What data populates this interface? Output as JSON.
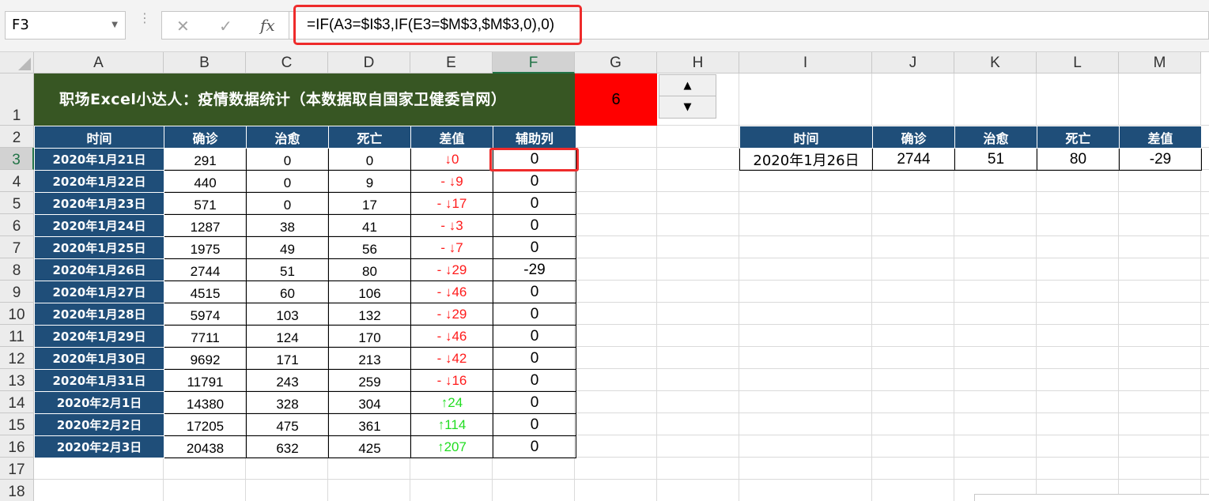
{
  "formula_bar": {
    "name_box": "F3",
    "cancel_glyph": "✕",
    "enter_glyph": "✓",
    "fx_label": "fx",
    "formula": "=IF(A3=$I$3,IF(E3=$M$3,$M$3,0),0)"
  },
  "columns": [
    "A",
    "B",
    "C",
    "D",
    "E",
    "F",
    "G",
    "H",
    "I",
    "J",
    "K",
    "L",
    "M"
  ],
  "selected_column": "F",
  "rows": [
    "1",
    "2",
    "3",
    "4",
    "5",
    "6",
    "7",
    "8",
    "9",
    "10",
    "11",
    "12",
    "13",
    "14",
    "15",
    "16",
    "17",
    "18"
  ],
  "selected_row": "3",
  "title": "职场Excel小达人：疫情数据统计（本数据取自国家卫健委官网）",
  "spinner_value": "6",
  "spinner": {
    "up": "▲",
    "down": "▼"
  },
  "main_table": {
    "headers": [
      "时间",
      "确诊",
      "治愈",
      "死亡",
      "差值",
      "辅助列"
    ],
    "rows": [
      {
        "date": "2020年1月21日",
        "confirmed": "291",
        "cured": "0",
        "dead": "0",
        "diff": "↓0",
        "dir": "down",
        "aux": "0"
      },
      {
        "date": "2020年1月22日",
        "confirmed": "440",
        "cured": "0",
        "dead": "9",
        "diff": "- ↓9",
        "dir": "down",
        "aux": "0"
      },
      {
        "date": "2020年1月23日",
        "confirmed": "571",
        "cured": "0",
        "dead": "17",
        "diff": "- ↓17",
        "dir": "down",
        "aux": "0"
      },
      {
        "date": "2020年1月24日",
        "confirmed": "1287",
        "cured": "38",
        "dead": "41",
        "diff": "- ↓3",
        "dir": "down",
        "aux": "0"
      },
      {
        "date": "2020年1月25日",
        "confirmed": "1975",
        "cured": "49",
        "dead": "56",
        "diff": "- ↓7",
        "dir": "down",
        "aux": "0"
      },
      {
        "date": "2020年1月26日",
        "confirmed": "2744",
        "cured": "51",
        "dead": "80",
        "diff": "- ↓29",
        "dir": "down",
        "aux": "-29"
      },
      {
        "date": "2020年1月27日",
        "confirmed": "4515",
        "cured": "60",
        "dead": "106",
        "diff": "- ↓46",
        "dir": "down",
        "aux": "0"
      },
      {
        "date": "2020年1月28日",
        "confirmed": "5974",
        "cured": "103",
        "dead": "132",
        "diff": "- ↓29",
        "dir": "down",
        "aux": "0"
      },
      {
        "date": "2020年1月29日",
        "confirmed": "7711",
        "cured": "124",
        "dead": "170",
        "diff": "- ↓46",
        "dir": "down",
        "aux": "0"
      },
      {
        "date": "2020年1月30日",
        "confirmed": "9692",
        "cured": "171",
        "dead": "213",
        "diff": "- ↓42",
        "dir": "down",
        "aux": "0"
      },
      {
        "date": "2020年1月31日",
        "confirmed": "11791",
        "cured": "243",
        "dead": "259",
        "diff": "- ↓16",
        "dir": "down",
        "aux": "0"
      },
      {
        "date": "2020年2月1日",
        "confirmed": "14380",
        "cured": "328",
        "dead": "304",
        "diff": "↑24",
        "dir": "up",
        "aux": "0"
      },
      {
        "date": "2020年2月2日",
        "confirmed": "17205",
        "cured": "475",
        "dead": "361",
        "diff": "↑114",
        "dir": "up",
        "aux": "0"
      },
      {
        "date": "2020年2月3日",
        "confirmed": "20438",
        "cured": "632",
        "dead": "425",
        "diff": "↑207",
        "dir": "up",
        "aux": "0"
      }
    ]
  },
  "lookup_table": {
    "headers": [
      "时间",
      "确诊",
      "治愈",
      "死亡",
      "差值"
    ],
    "row": [
      "2020年1月26日",
      "2744",
      "51",
      "80",
      "-29"
    ]
  },
  "colors": {
    "title_bg": "#375623",
    "header_bg": "#1f4e79",
    "highlight": "#ff0000",
    "down": "#ff1b1b",
    "up": "#22dd22",
    "accent": "#217346"
  }
}
